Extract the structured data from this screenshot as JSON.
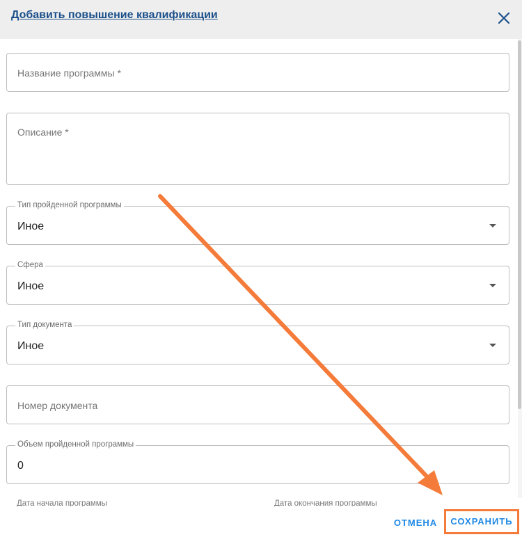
{
  "dialog": {
    "title": "Добавить повышение квалификации",
    "close_icon": "close-icon"
  },
  "form": {
    "program_name": {
      "placeholder": "Название программы *"
    },
    "description": {
      "placeholder": "Описание *"
    },
    "program_type": {
      "label": "Тип пройденной программы",
      "value": "Иное"
    },
    "sphere": {
      "label": "Сфера",
      "value": "Иное"
    },
    "document_type": {
      "label": "Тип документа",
      "value": "Иное"
    },
    "document_number": {
      "placeholder": "Номер документа"
    },
    "program_volume": {
      "label": "Объем пройденной программы",
      "value": "0"
    },
    "start_date": {
      "label": "Дата начала программы"
    },
    "end_date": {
      "label": "Дата окончания программы"
    }
  },
  "actions": {
    "cancel_label": "ОТМЕНА",
    "save_label": "СОХРАНИТЬ"
  },
  "colors": {
    "title": "#1b4f8a",
    "button": "#1e88e5",
    "annotation": "#f47b3a"
  }
}
